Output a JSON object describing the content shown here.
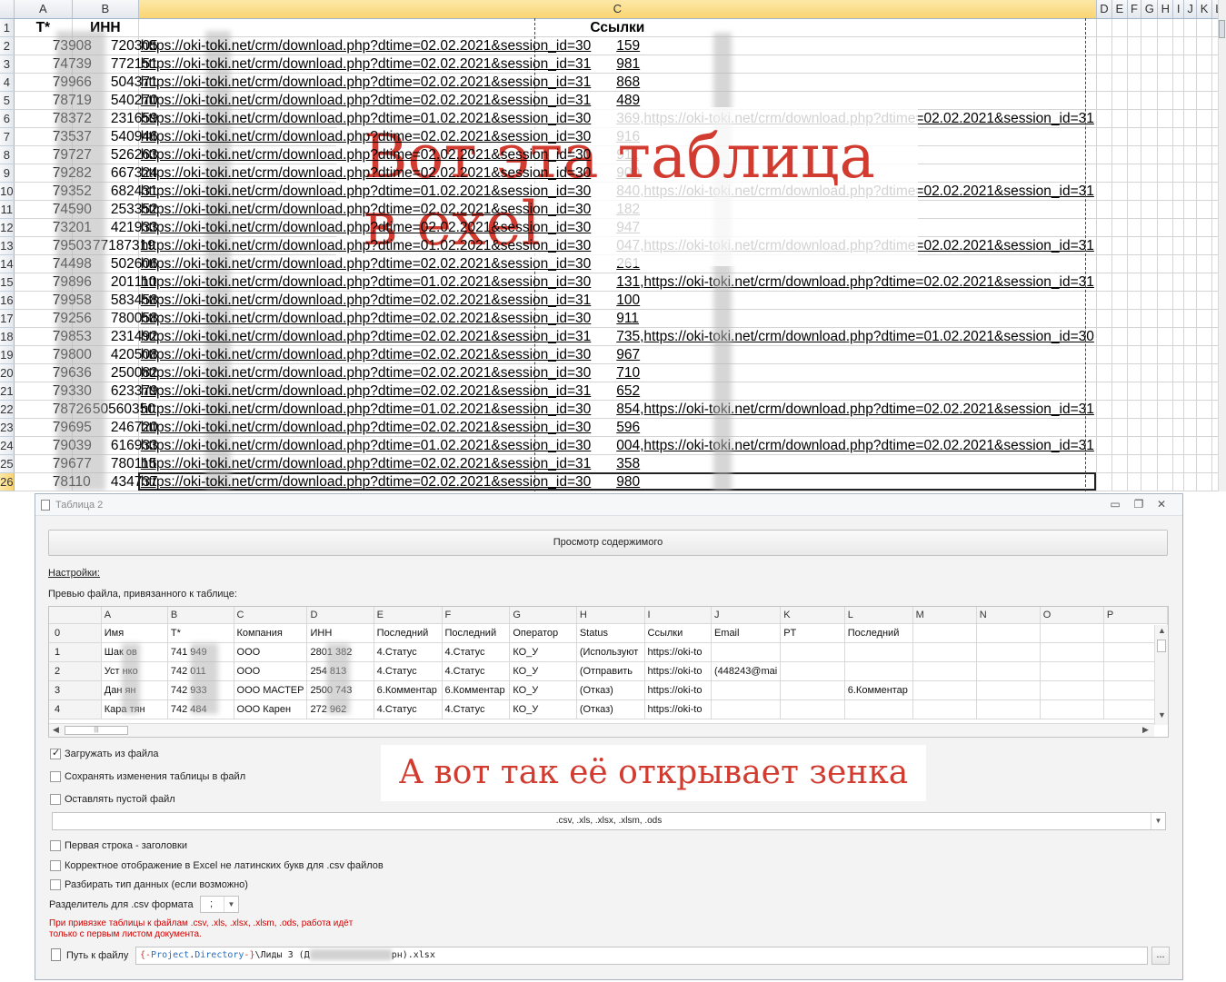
{
  "excel": {
    "columns": [
      "A",
      "B",
      "C",
      "D",
      "E",
      "F",
      "G",
      "H",
      "I",
      "J",
      "K",
      "L"
    ],
    "active_column": "C",
    "active_row": "26",
    "header_row": {
      "num": "1",
      "a": "T*",
      "b": "ИНН",
      "c": "Ссылки"
    },
    "rows": [
      {
        "num": "2",
        "a": "73",
        "a2": "908",
        "b": "720",
        "b2": "305",
        "c": "https://oki-toki.net/crm/download.php?dtime=02.02.2021&session_id=30",
        "c2": "159"
      },
      {
        "num": "3",
        "a": "74",
        "a2": "739",
        "b": "772",
        "b2": "151",
        "c": "https://oki-toki.net/crm/download.php?dtime=02.02.2021&session_id=31",
        "c2": "981"
      },
      {
        "num": "4",
        "a": "79",
        "a2": "966",
        "b": "504",
        "b2": "371",
        "c": "https://oki-toki.net/crm/download.php?dtime=02.02.2021&session_id=31",
        "c2": "868"
      },
      {
        "num": "5",
        "a": "78",
        "a2": "719",
        "b": "540",
        "b2": "270",
        "c": "https://oki-toki.net/crm/download.php?dtime=02.02.2021&session_id=31",
        "c2": "489"
      },
      {
        "num": "6",
        "a": "78",
        "a2": "372",
        "b": "231",
        "b2": "659",
        "c": "https://oki-toki.net/crm/download.php?dtime=01.02.2021&session_id=30",
        "c2": "369,https://oki-toki.net/crm/download.php?dtime=02.02.2021&session_id=31"
      },
      {
        "num": "7",
        "a": "73",
        "a2": "537",
        "b": "540",
        "b2": "946",
        "c": "https://oki-toki.net/crm/download.php?dtime=02.02.2021&session_id=30",
        "c2": "916"
      },
      {
        "num": "8",
        "a": "79",
        "a2": "727",
        "b": "526",
        "b2": "263",
        "c": "https://oki-toki.net/crm/download.php?dtime=02.02.2021&session_id=30",
        "c2": "911"
      },
      {
        "num": "9",
        "a": "79",
        "a2": "282",
        "b": "667",
        "b2": "324",
        "c": "https://oki-toki.net/crm/download.php?dtime=02.02.2021&session_id=30",
        "c2": "900"
      },
      {
        "num": "10",
        "a": "79",
        "a2": "352",
        "b": "682",
        "b2": "431",
        "c": "https://oki-toki.net/crm/download.php?dtime=01.02.2021&session_id=30",
        "c2": "840,https://oki-toki.net/crm/download.php?dtime=02.02.2021&session_id=31"
      },
      {
        "num": "11",
        "a": "74",
        "a2": "590",
        "b": "253",
        "b2": "352",
        "c": "https://oki-toki.net/crm/download.php?dtime=02.02.2021&session_id=30",
        "c2": "182"
      },
      {
        "num": "12",
        "a": "73",
        "a2": "201",
        "b": "421",
        "b2": "933",
        "c": "https://oki-toki.net/crm/download.php?dtime=02.02.2021&session_id=30",
        "c2": "947"
      },
      {
        "num": "13",
        "a": "79",
        "a2": "503",
        "b": "77187",
        "b2": "319",
        "c": "https://oki-toki.net/crm/download.php?dtime=01.02.2021&session_id=30",
        "c2": "047,https://oki-toki.net/crm/download.php?dtime=02.02.2021&session_id=31"
      },
      {
        "num": "14",
        "a": "74",
        "a2": "498",
        "b": "502",
        "b2": "606",
        "c": "https://oki-toki.net/crm/download.php?dtime=02.02.2021&session_id=30",
        "c2": "261"
      },
      {
        "num": "15",
        "a": "79",
        "a2": "896",
        "b": "201",
        "b2": "110",
        "c": "https://oki-toki.net/crm/download.php?dtime=01.02.2021&session_id=30",
        "c2": "131,https://oki-toki.net/crm/download.php?dtime=02.02.2021&session_id=31"
      },
      {
        "num": "16",
        "a": "79",
        "a2": "958",
        "b": "583",
        "b2": "458",
        "c": "https://oki-toki.net/crm/download.php?dtime=02.02.2021&session_id=31",
        "c2": "100"
      },
      {
        "num": "17",
        "a": "79",
        "a2": "256",
        "b": "780",
        "b2": "058",
        "c": "https://oki-toki.net/crm/download.php?dtime=02.02.2021&session_id=30",
        "c2": "911"
      },
      {
        "num": "18",
        "a": "79",
        "a2": "853",
        "b": "231",
        "b2": "492",
        "c": "https://oki-toki.net/crm/download.php?dtime=02.02.2021&session_id=31",
        "c2": "735,https://oki-toki.net/crm/download.php?dtime=01.02.2021&session_id=30"
      },
      {
        "num": "19",
        "a": "79",
        "a2": "800",
        "b": "420",
        "b2": "508",
        "c": "https://oki-toki.net/crm/download.php?dtime=02.02.2021&session_id=30",
        "c2": "967"
      },
      {
        "num": "20",
        "a": "79",
        "a2": "636",
        "b": "250",
        "b2": "082",
        "c": "https://oki-toki.net/crm/download.php?dtime=02.02.2021&session_id=30",
        "c2": "710"
      },
      {
        "num": "21",
        "a": "79",
        "a2": "330",
        "b": "623",
        "b2": "379",
        "c": "https://oki-toki.net/crm/download.php?dtime=02.02.2021&session_id=31",
        "c2": "652"
      },
      {
        "num": "22",
        "a": "78",
        "a2": "726",
        "b": "50560",
        "b2": "350",
        "c": "https://oki-toki.net/crm/download.php?dtime=01.02.2021&session_id=30",
        "c2": "854,https://oki-toki.net/crm/download.php?dtime=02.02.2021&session_id=31"
      },
      {
        "num": "23",
        "a": "79",
        "a2": "695",
        "b": "246",
        "b2": "720",
        "c": "https://oki-toki.net/crm/download.php?dtime=02.02.2021&session_id=30",
        "c2": "596"
      },
      {
        "num": "24",
        "a": "79",
        "a2": "039",
        "b": "616",
        "b2": "933",
        "c": "https://oki-toki.net/crm/download.php?dtime=01.02.2021&session_id=30",
        "c2": "004,https://oki-toki.net/crm/download.php?dtime=02.02.2021&session_id=31"
      },
      {
        "num": "25",
        "a": "79",
        "a2": "677",
        "b": "780",
        "b2": "115",
        "c": "https://oki-toki.net/crm/download.php?dtime=02.02.2021&session_id=31",
        "c2": "358"
      },
      {
        "num": "26",
        "a": "78",
        "a2": "110",
        "b": "434",
        "b2": "737",
        "c": "https://oki-toki.net/crm/download.php?dtime=02.02.2021&session_id=30",
        "c2": "980"
      }
    ],
    "overlay_line1": "Вот эта таблица",
    "overlay_line2": "в exel",
    "overlay_color": "#d23b30"
  },
  "dialog": {
    "title": "Таблица 2",
    "win_buttons": {
      "min": "▭",
      "max": "❐",
      "close": "✕"
    },
    "view_button": "Просмотр содержимого",
    "settings_label": "Настройки:",
    "preview_label": "Превью файла, привязанного к таблице:",
    "grid": {
      "col_letters": [
        "",
        "A",
        "B",
        "C",
        "D",
        "E",
        "F",
        "G",
        "H",
        "I",
        "J",
        "K",
        "L",
        "M",
        "N",
        "O",
        "P"
      ],
      "rows": [
        [
          "0",
          "Имя",
          "T*",
          "Компания",
          "ИНН",
          "Последний",
          "Последний",
          "Оператор",
          "Status",
          "Ссылки",
          "Email",
          "PT",
          "Последний",
          "",
          "",
          "",
          ""
        ],
        [
          "1",
          "Шак      ов",
          "741       949",
          "ООО",
          "2801      382",
          "4.Статус",
          "4.Статус",
          "КО_У",
          "(Используют",
          "https://oki-to",
          "",
          "",
          "",
          "",
          "",
          "",
          ""
        ],
        [
          "2",
          "Уст      нко",
          "742       011",
          "ООО",
          "254      813",
          "4.Статус",
          "4.Статус",
          "КО_У",
          "(Отправить",
          "https://oki-to",
          "(448243@mai",
          "",
          "",
          "",
          "",
          "",
          ""
        ],
        [
          "3",
          "Дан      ян",
          "742       933",
          "ООО МАСТЕР",
          "2500      743",
          "6.Комментар",
          "6.Комментар",
          "КО_У",
          "(Отказ)",
          "https://oki-to",
          "",
          "",
          "6.Комментар",
          "",
          "",
          "",
          ""
        ],
        [
          "4",
          "Кара      тян",
          "742       484",
          "ООО Карен",
          "272      962",
          "4.Статус",
          "4.Статус",
          "КО_У",
          "(Отказ)",
          "https://oki-to",
          "",
          "",
          "",
          "",
          "",
          "",
          ""
        ]
      ]
    },
    "cb_load_from_file": "Загружать из файла",
    "cb_save_changes": "Сохранять изменения таблицы в файл",
    "cb_leave_empty": "Оставлять пустой файл",
    "file_types": ".csv, .xls, .xlsx, .xlsm, .ods",
    "cb_first_row_headers": "Первая строка - заголовки",
    "cb_excel_display": "Корректное отображение в Excel не латинских букв для .csv файлов",
    "cb_parse_type": "Разбирать тип данных (если возможно)",
    "separator_label": "Разделитель для .csv формата",
    "separator_value": ";",
    "warning": "При привязке таблицы к файлам .csv, .xls, .xlsx, .xlsm, .ods, работа идёт только с первым листом документа.",
    "path_label": "Путь к файлу",
    "path_parts": {
      "p1": "{-",
      "p2": "Project",
      "p3": ".",
      "p4": "Directory",
      "p5": "-}",
      "p6": "\\Лиды 3 (Д",
      "p7": "рн).xlsx"
    },
    "browse_label": "...",
    "overlay_text": "А вот так её открывает зенка",
    "overlay_color": "#d23b30"
  }
}
